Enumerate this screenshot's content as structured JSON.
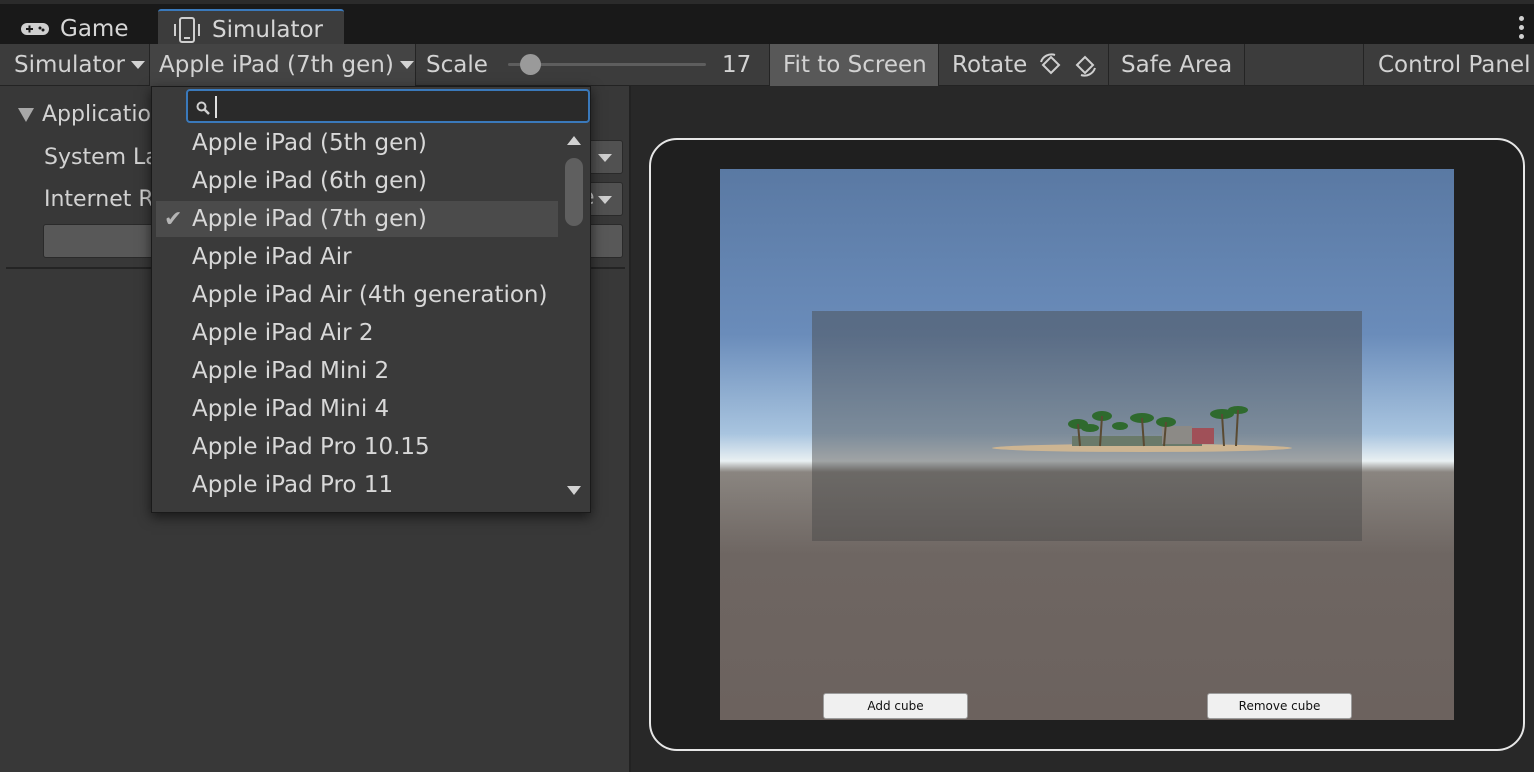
{
  "tabs": [
    {
      "label": "Game",
      "icon": "gamepad-icon"
    },
    {
      "label": "Simulator",
      "icon": "phone-device-icon"
    }
  ],
  "toolbar": {
    "simulator_menu": "Simulator",
    "device_select": "Apple iPad (7th gen)",
    "scale_label": "Scale",
    "scale_value": "17",
    "fit_to_screen": "Fit to Screen",
    "rotate_label": "Rotate",
    "safe_area": "Safe Area",
    "control_panel": "Control Panel"
  },
  "left_panel": {
    "section_title": "Applicatio",
    "rows": [
      "System La",
      "Internet R"
    ],
    "dropdown_fragment": "e"
  },
  "device_dropdown": {
    "search_placeholder": "",
    "options": [
      "Apple iPad (5th gen)",
      "Apple iPad (6th gen)",
      "Apple iPad (7th gen)",
      "Apple iPad Air",
      "Apple iPad Air (4th generation)",
      "Apple iPad Air 2",
      "Apple iPad Mini 2",
      "Apple iPad Mini 4",
      "Apple iPad Pro 10.15",
      "Apple iPad Pro 11"
    ],
    "selected_index": 2
  },
  "game_view": {
    "add_button": "Add cube",
    "remove_button": "Remove cube"
  },
  "colors": {
    "accent": "#3a79bb",
    "panel": "#383838",
    "toolbar": "#3c3c3c"
  }
}
